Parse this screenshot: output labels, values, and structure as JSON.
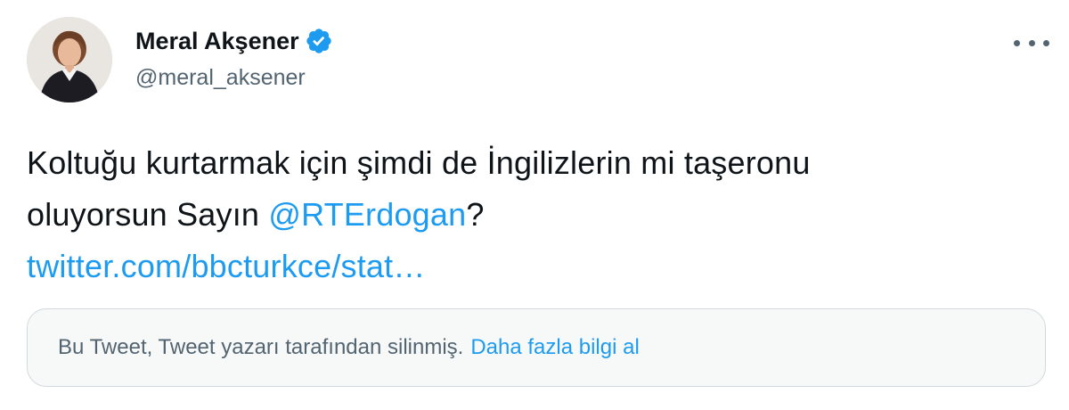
{
  "author": {
    "display_name": "Meral Akşener",
    "handle": "@meral_aksener",
    "verified": true,
    "avatar_icon": "profile-photo"
  },
  "tweet": {
    "line1": "Koltuğu kurtarmak için şimdi de İngilizlerin mi taşeronu",
    "line2_prefix": "oluyorsun Sayın ",
    "mention": "@RTErdogan",
    "line2_suffix": "?",
    "link_text": "twitter.com/bbcturkce/stat…"
  },
  "quoted_notice": {
    "message": "Bu Tweet, Tweet yazarı tarafından silinmiş.",
    "learn_more": "Daha fazla bilgi al"
  },
  "colors": {
    "text": "#0f1419",
    "secondary": "#536471",
    "accent": "#1d9bf0",
    "notice_bg": "#f7f9f9",
    "border": "#cfd9de"
  }
}
